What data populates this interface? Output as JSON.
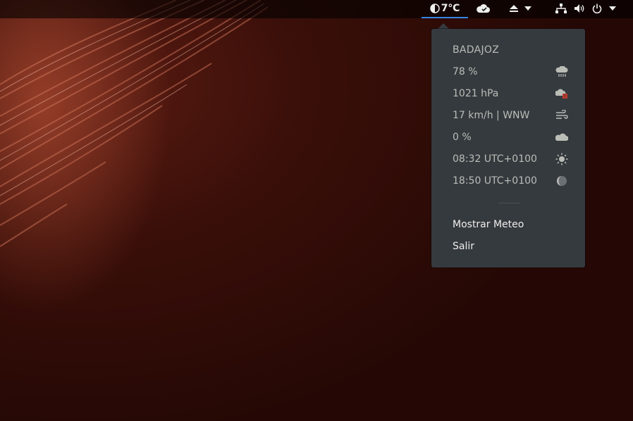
{
  "topbar": {
    "weather_temp": "7°C",
    "icons": [
      "moon-weather-icon",
      "cloud-check-icon",
      "eject-icon",
      "network-icon",
      "volume-icon",
      "power-icon"
    ]
  },
  "weather_popup": {
    "city": "BADAJOZ",
    "rows": [
      {
        "value": "78 %",
        "icon": "rain-humidity-icon"
      },
      {
        "value": "1021 hPa",
        "icon": "pressure-icon"
      },
      {
        "value": "17 km/h | WNW",
        "icon": "wind-icon"
      },
      {
        "value": "0 %",
        "icon": "cloudiness-icon"
      },
      {
        "value": "08:32 UTC+0100",
        "icon": "sunrise-icon"
      },
      {
        "value": "18:50 UTC+0100",
        "icon": "sunset-moon-icon"
      }
    ],
    "menu": {
      "show_weather": "Mostrar Meteo",
      "exit": "Salir"
    }
  },
  "colors": {
    "accent": "#3584e4",
    "popup_bg": "#353a3f",
    "muted_text": "#babdb6",
    "text": "#eeeeec",
    "pressure_badge": "#c0392b"
  }
}
